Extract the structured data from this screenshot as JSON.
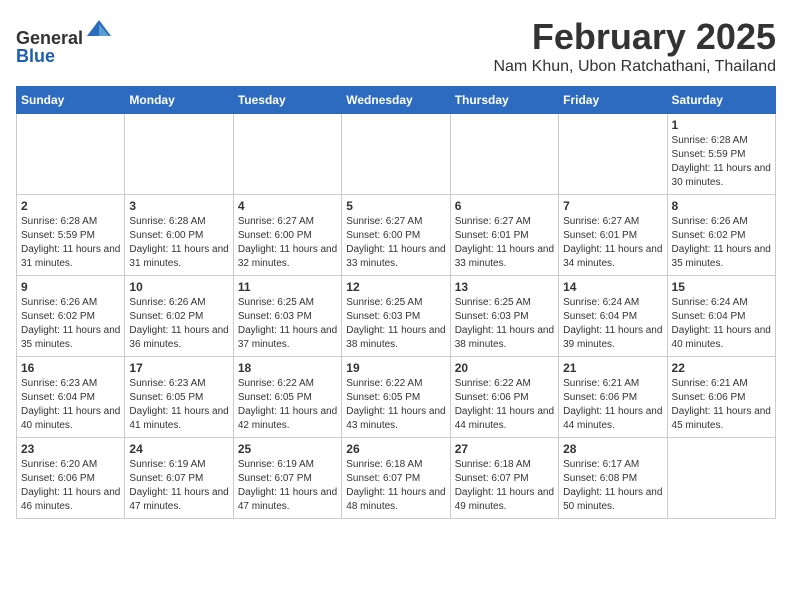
{
  "header": {
    "logo_line1": "General",
    "logo_line2": "Blue",
    "title": "February 2025",
    "subtitle": "Nam Khun, Ubon Ratchathani, Thailand"
  },
  "calendar": {
    "days_of_week": [
      "Sunday",
      "Monday",
      "Tuesday",
      "Wednesday",
      "Thursday",
      "Friday",
      "Saturday"
    ],
    "weeks": [
      [
        {
          "day": "",
          "info": ""
        },
        {
          "day": "",
          "info": ""
        },
        {
          "day": "",
          "info": ""
        },
        {
          "day": "",
          "info": ""
        },
        {
          "day": "",
          "info": ""
        },
        {
          "day": "",
          "info": ""
        },
        {
          "day": "1",
          "info": "Sunrise: 6:28 AM\nSunset: 5:59 PM\nDaylight: 11 hours and 30 minutes."
        }
      ],
      [
        {
          "day": "2",
          "info": "Sunrise: 6:28 AM\nSunset: 5:59 PM\nDaylight: 11 hours and 31 minutes."
        },
        {
          "day": "3",
          "info": "Sunrise: 6:28 AM\nSunset: 6:00 PM\nDaylight: 11 hours and 31 minutes."
        },
        {
          "day": "4",
          "info": "Sunrise: 6:27 AM\nSunset: 6:00 PM\nDaylight: 11 hours and 32 minutes."
        },
        {
          "day": "5",
          "info": "Sunrise: 6:27 AM\nSunset: 6:00 PM\nDaylight: 11 hours and 33 minutes."
        },
        {
          "day": "6",
          "info": "Sunrise: 6:27 AM\nSunset: 6:01 PM\nDaylight: 11 hours and 33 minutes."
        },
        {
          "day": "7",
          "info": "Sunrise: 6:27 AM\nSunset: 6:01 PM\nDaylight: 11 hours and 34 minutes."
        },
        {
          "day": "8",
          "info": "Sunrise: 6:26 AM\nSunset: 6:02 PM\nDaylight: 11 hours and 35 minutes."
        }
      ],
      [
        {
          "day": "9",
          "info": "Sunrise: 6:26 AM\nSunset: 6:02 PM\nDaylight: 11 hours and 35 minutes."
        },
        {
          "day": "10",
          "info": "Sunrise: 6:26 AM\nSunset: 6:02 PM\nDaylight: 11 hours and 36 minutes."
        },
        {
          "day": "11",
          "info": "Sunrise: 6:25 AM\nSunset: 6:03 PM\nDaylight: 11 hours and 37 minutes."
        },
        {
          "day": "12",
          "info": "Sunrise: 6:25 AM\nSunset: 6:03 PM\nDaylight: 11 hours and 38 minutes."
        },
        {
          "day": "13",
          "info": "Sunrise: 6:25 AM\nSunset: 6:03 PM\nDaylight: 11 hours and 38 minutes."
        },
        {
          "day": "14",
          "info": "Sunrise: 6:24 AM\nSunset: 6:04 PM\nDaylight: 11 hours and 39 minutes."
        },
        {
          "day": "15",
          "info": "Sunrise: 6:24 AM\nSunset: 6:04 PM\nDaylight: 11 hours and 40 minutes."
        }
      ],
      [
        {
          "day": "16",
          "info": "Sunrise: 6:23 AM\nSunset: 6:04 PM\nDaylight: 11 hours and 40 minutes."
        },
        {
          "day": "17",
          "info": "Sunrise: 6:23 AM\nSunset: 6:05 PM\nDaylight: 11 hours and 41 minutes."
        },
        {
          "day": "18",
          "info": "Sunrise: 6:22 AM\nSunset: 6:05 PM\nDaylight: 11 hours and 42 minutes."
        },
        {
          "day": "19",
          "info": "Sunrise: 6:22 AM\nSunset: 6:05 PM\nDaylight: 11 hours and 43 minutes."
        },
        {
          "day": "20",
          "info": "Sunrise: 6:22 AM\nSunset: 6:06 PM\nDaylight: 11 hours and 44 minutes."
        },
        {
          "day": "21",
          "info": "Sunrise: 6:21 AM\nSunset: 6:06 PM\nDaylight: 11 hours and 44 minutes."
        },
        {
          "day": "22",
          "info": "Sunrise: 6:21 AM\nSunset: 6:06 PM\nDaylight: 11 hours and 45 minutes."
        }
      ],
      [
        {
          "day": "23",
          "info": "Sunrise: 6:20 AM\nSunset: 6:06 PM\nDaylight: 11 hours and 46 minutes."
        },
        {
          "day": "24",
          "info": "Sunrise: 6:19 AM\nSunset: 6:07 PM\nDaylight: 11 hours and 47 minutes."
        },
        {
          "day": "25",
          "info": "Sunrise: 6:19 AM\nSunset: 6:07 PM\nDaylight: 11 hours and 47 minutes."
        },
        {
          "day": "26",
          "info": "Sunrise: 6:18 AM\nSunset: 6:07 PM\nDaylight: 11 hours and 48 minutes."
        },
        {
          "day": "27",
          "info": "Sunrise: 6:18 AM\nSunset: 6:07 PM\nDaylight: 11 hours and 49 minutes."
        },
        {
          "day": "28",
          "info": "Sunrise: 6:17 AM\nSunset: 6:08 PM\nDaylight: 11 hours and 50 minutes."
        },
        {
          "day": "",
          "info": ""
        }
      ]
    ]
  }
}
